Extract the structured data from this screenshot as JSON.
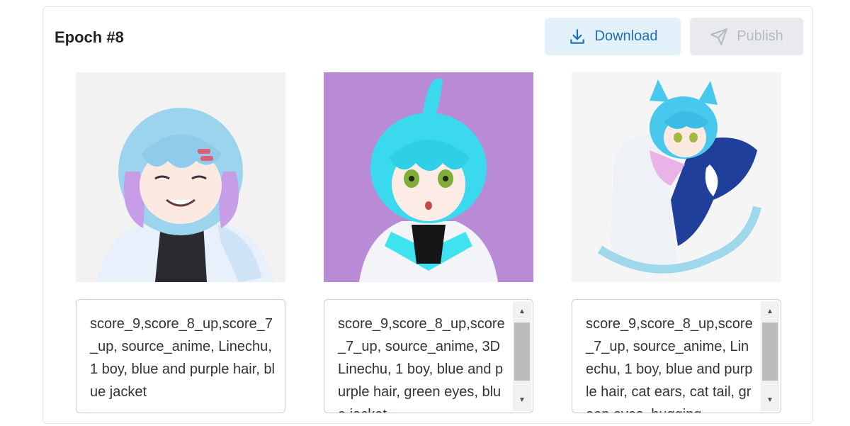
{
  "card": {
    "title": "Epoch #8",
    "download_label": "Download",
    "publish_label": "Publish"
  },
  "images": [
    {
      "icon": "portrait-blue-purple-hair-smiling"
    },
    {
      "icon": "portrait-cyan-hair-purple-background"
    },
    {
      "icon": "portrait-cat-ears-hugging-tail"
    }
  ],
  "prompts": [
    {
      "text": "score_9,score_8_up,score_7_up, source_anime, Linechu, 1 boy, blue and purple hair, blue jacket"
    },
    {
      "text": "score_9,score_8_up,score_7_up, source_anime, 3D Linechu, 1 boy, blue and purple hair, green eyes, blue jacket"
    },
    {
      "text": "score_9,score_8_up,score_7_up, source_anime, Linechu, 1 boy, blue and purple hair, cat ears, cat tail, green eyes, hugging"
    }
  ],
  "colors": {
    "download_bg": "#e3f1fb",
    "download_fg": "#1e6fb5",
    "publish_bg": "#e8eaed",
    "publish_fg": "#b6bcc4"
  }
}
